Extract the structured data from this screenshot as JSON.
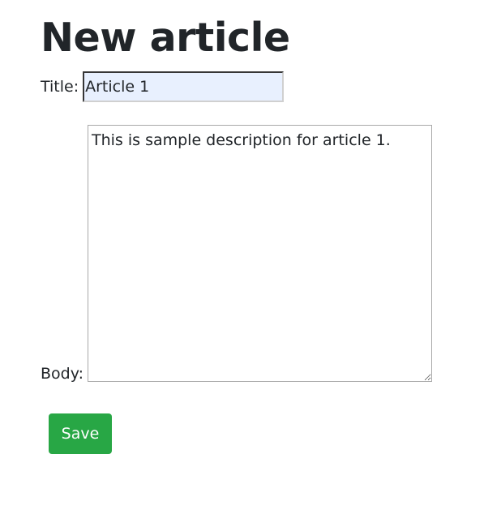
{
  "page": {
    "title": "New article"
  },
  "form": {
    "title_label": "Title:",
    "title_value": "Article 1",
    "body_label": "Body:",
    "body_value": "This is sample description for article 1.",
    "save_label": "Save"
  },
  "colors": {
    "save_button": "#28a745",
    "autofill_background": "#e8f0fe",
    "text": "#212529"
  }
}
